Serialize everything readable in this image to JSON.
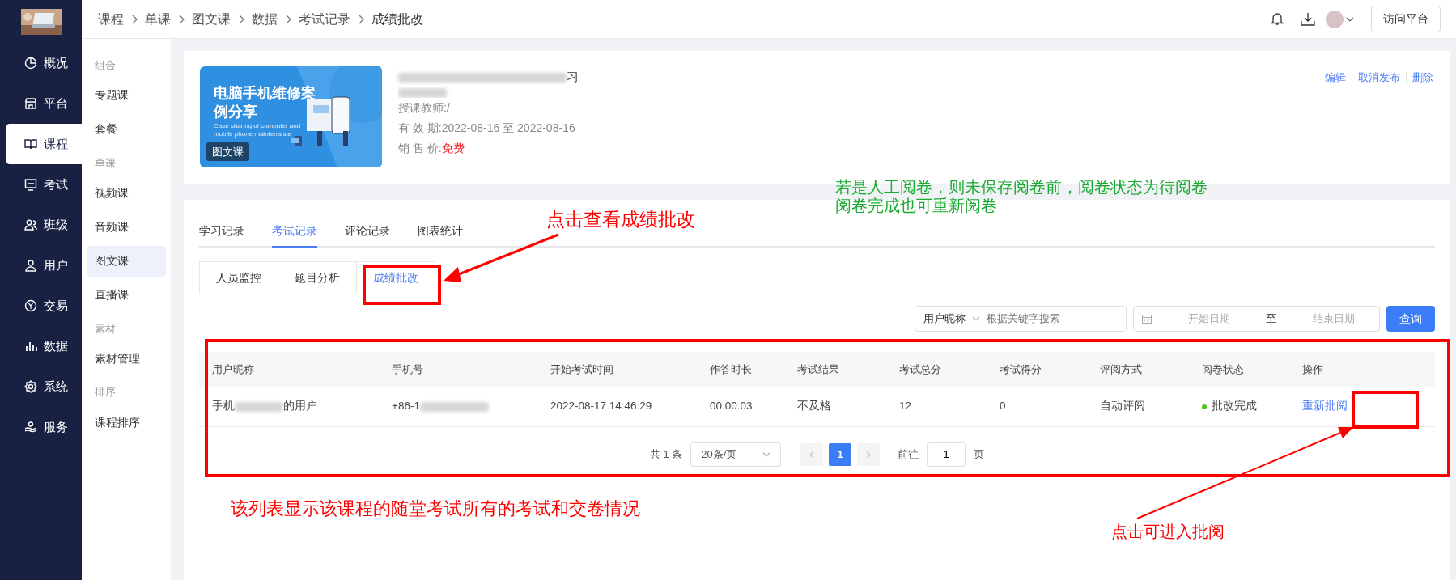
{
  "sidebar": {
    "items": [
      {
        "label": "概况",
        "kind": "pie",
        "selected": false
      },
      {
        "label": "平台",
        "kind": "store",
        "selected": false
      },
      {
        "label": "课程",
        "kind": "book",
        "selected": true
      },
      {
        "label": "考试",
        "kind": "exam",
        "selected": false
      },
      {
        "label": "班级",
        "kind": "group",
        "selected": false
      },
      {
        "label": "用户",
        "kind": "user",
        "selected": false
      },
      {
        "label": "交易",
        "kind": "coin",
        "selected": false
      },
      {
        "label": "数据",
        "kind": "bars",
        "selected": false
      },
      {
        "label": "系统",
        "kind": "gear",
        "selected": false
      },
      {
        "label": "服务",
        "kind": "hand",
        "selected": false
      }
    ]
  },
  "breadcrumb": [
    "课程",
    "单课",
    "图文课",
    "数据",
    "考试记录",
    "成绩批改"
  ],
  "header": {
    "visit_button": "访问平台"
  },
  "subnav": {
    "groups": [
      {
        "title": "组合",
        "items": [
          {
            "label": "专题课",
            "selected": false
          },
          {
            "label": "套餐",
            "selected": false
          }
        ]
      },
      {
        "title": "单课",
        "items": [
          {
            "label": "视频课",
            "selected": false
          },
          {
            "label": "音频课",
            "selected": false
          },
          {
            "label": "图文课",
            "selected": true
          },
          {
            "label": "直播课",
            "selected": false
          }
        ]
      },
      {
        "title": "素材",
        "items": [
          {
            "label": "素材管理",
            "selected": false
          }
        ]
      },
      {
        "title": "排序",
        "items": [
          {
            "label": "课程排序",
            "selected": false
          }
        ]
      }
    ]
  },
  "course": {
    "cover": {
      "title": "电脑手机维修案例分享",
      "subtitle": "Case sharing of computer and mobile phone maintenance",
      "badge": "图文课"
    },
    "title_end": "习",
    "fields": [
      {
        "label": "授课教师:",
        "value": "/",
        "kind": "plain"
      },
      {
        "label": "有 效 期:",
        "value": "2022-08-16 至 2022-08-16",
        "kind": "plain"
      },
      {
        "label": "销 售 价:",
        "value": "免费",
        "kind": "price"
      }
    ],
    "actions": [
      "编辑",
      "取消发布",
      "删除"
    ]
  },
  "tabs": [
    {
      "label": "学习记录",
      "selected": false
    },
    {
      "label": "考试记录",
      "selected": true
    },
    {
      "label": "评论记录",
      "selected": false
    },
    {
      "label": "图表统计",
      "selected": false
    }
  ],
  "subtabs": [
    {
      "label": "人员监控",
      "selected": false
    },
    {
      "label": "题目分析",
      "selected": false
    },
    {
      "label": "成绩批改",
      "selected": true
    }
  ],
  "filter": {
    "field": "用户昵称",
    "placeholder": "根据关键字搜索",
    "start_placeholder": "开始日期",
    "separator": "至",
    "end_placeholder": "结束日期",
    "button": "查询"
  },
  "table": {
    "columns": [
      "用户昵称",
      "手机号",
      "开始考试时间",
      "作答时长",
      "考试结果",
      "考试总分",
      "考试得分",
      "评阅方式",
      "阅卷状态",
      "操作"
    ],
    "rows": [
      {
        "cells": [
          {
            "kind": "masked",
            "start": "手机",
            "end": "的用户"
          },
          {
            "kind": "masked",
            "start": "+86-1"
          },
          {
            "kind": "plain",
            "text": "2022-08-17 14:46:29"
          },
          {
            "kind": "plain",
            "text": "00:00:03"
          },
          {
            "kind": "plain",
            "text": "不及格"
          },
          {
            "kind": "plain",
            "text": "12"
          },
          {
            "kind": "plain",
            "text": "0"
          },
          {
            "kind": "plain",
            "text": "自动评阅"
          },
          {
            "kind": "status",
            "text": "批改完成",
            "color": "#52c41a"
          },
          {
            "kind": "link",
            "text": "重新批阅"
          }
        ]
      }
    ]
  },
  "pagination": {
    "total": "共 1 条",
    "page_size": "20条/页",
    "pages": [
      {
        "label": "1",
        "selected": true
      }
    ],
    "goto_label": "前往",
    "goto_value": "1",
    "goto_suffix": "页"
  },
  "annotations": [
    {
      "lines": [
        "点击查看成绩批改"
      ],
      "color": "#ff0000"
    },
    {
      "lines": [
        "若是人工阅卷，则未保存阅卷前，阅卷状态为待阅卷",
        "阅卷完成也可重新阅卷"
      ],
      "color": "#1aab32"
    },
    {
      "lines": [
        "该列表显示该课程的随堂考试所有的考试和交卷情况"
      ],
      "color": "#ff0000"
    },
    {
      "lines": [
        "点击可进入批阅"
      ],
      "color": "#ff0000"
    }
  ]
}
